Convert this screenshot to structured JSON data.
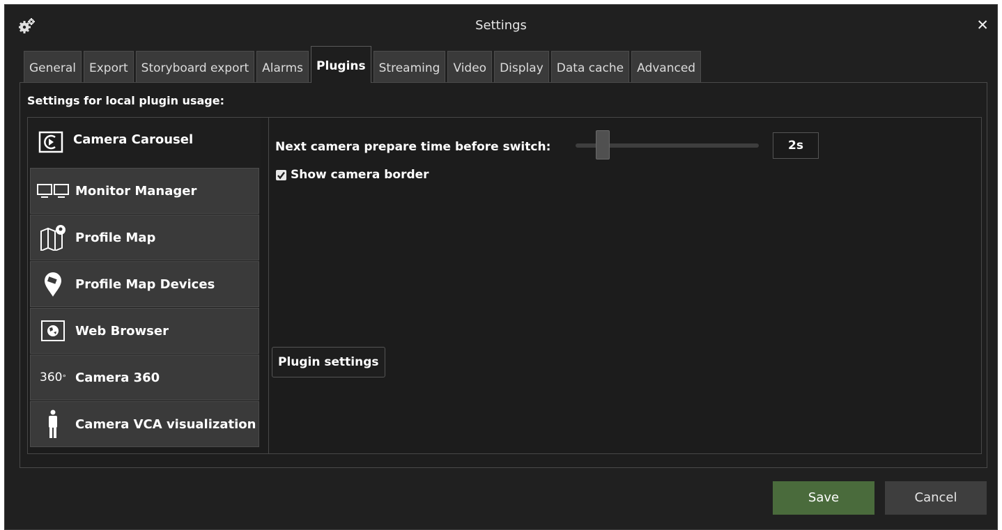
{
  "window": {
    "title": "Settings",
    "close_glyph": "✕"
  },
  "tabs": [
    {
      "label": "General",
      "active": false
    },
    {
      "label": "Export",
      "active": false
    },
    {
      "label": "Storyboard export",
      "active": false
    },
    {
      "label": "Alarms",
      "active": false
    },
    {
      "label": "Plugins",
      "active": true
    },
    {
      "label": "Streaming",
      "active": false
    },
    {
      "label": "Video",
      "active": false
    },
    {
      "label": "Display",
      "active": false
    },
    {
      "label": "Data cache",
      "active": false
    },
    {
      "label": "Advanced",
      "active": false
    }
  ],
  "plugins_section": {
    "heading": "Settings for local plugin usage:",
    "items": [
      {
        "label": "Camera Carousel",
        "icon": "camera-carousel-icon",
        "active": true
      },
      {
        "label": "Monitor Manager",
        "icon": "monitor-manager-icon",
        "active": false
      },
      {
        "label": "Profile Map",
        "icon": "profile-map-icon",
        "active": false
      },
      {
        "label": "Profile Map Devices",
        "icon": "map-pin-icon",
        "active": false
      },
      {
        "label": "Web Browser",
        "icon": "globe-icon",
        "active": false
      },
      {
        "label": "Camera 360",
        "icon": "camera-360-icon",
        "icon_text": "360",
        "icon_degree": "°",
        "active": false
      },
      {
        "label": "Camera VCA visualization",
        "icon": "person-icon",
        "active": false
      }
    ]
  },
  "camera_carousel": {
    "prepare_time_label": "Next camera prepare time before switch:",
    "prepare_time_value": "2s",
    "slider_fraction": 0.12,
    "show_border_label": "Show camera border",
    "show_border_checked": true,
    "plugin_settings_label": "Plugin settings"
  },
  "footer": {
    "save_label": "Save",
    "cancel_label": "Cancel"
  },
  "colors": {
    "background": "#202020",
    "tab_inactive": "#3a3a3a",
    "save_button": "#4a6b3c",
    "cancel_button": "#3e3e3e"
  }
}
